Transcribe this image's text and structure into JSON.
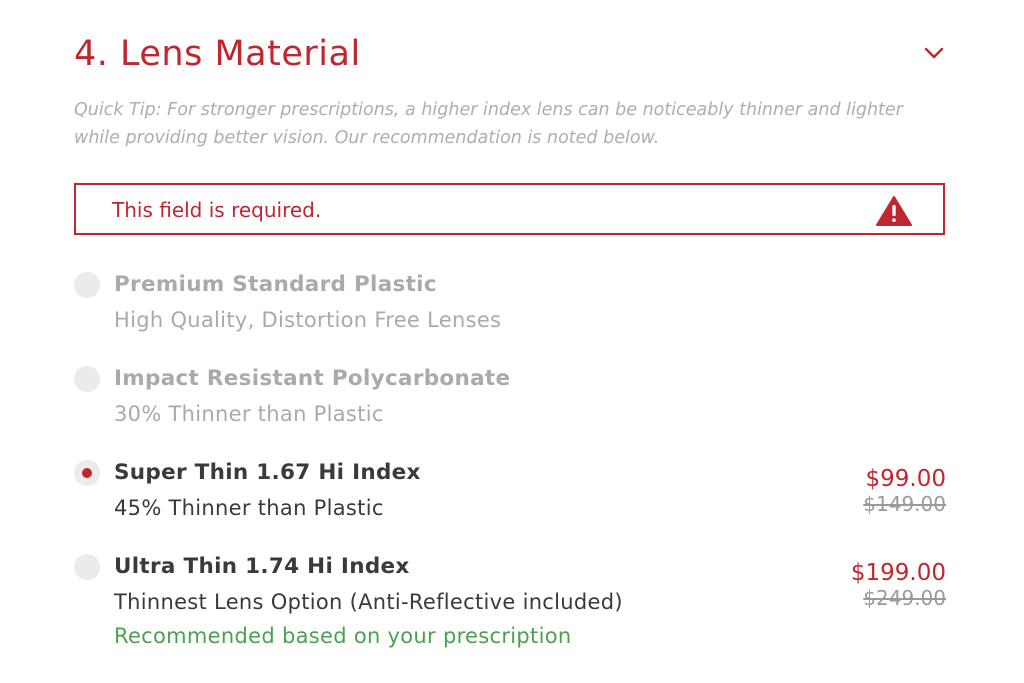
{
  "section": {
    "title": "4. Lens Material",
    "tip": "Quick Tip: For stronger prescriptions, a higher index lens can be noticeably thinner and lighter while providing better vision. Our recommendation is noted below.",
    "error": "This field is required."
  },
  "colors": {
    "accent": "#c0262d",
    "muted_text": "#aaaaaa",
    "active_text": "#3a3a3a",
    "recommend": "#4aa150"
  },
  "icons": {
    "collapse": "chevron-down-icon",
    "error": "warning-triangle-icon"
  },
  "options": [
    {
      "name": "Premium Standard Plastic",
      "desc": "High Quality, Distortion Free Lenses",
      "price": "",
      "old_price": "",
      "recommended": ""
    },
    {
      "name": "Impact Resistant Polycarbonate",
      "desc": "30% Thinner than Plastic",
      "price": "",
      "old_price": "",
      "recommended": ""
    },
    {
      "name": "Super Thin 1.67 Hi Index",
      "desc": "45% Thinner than Plastic",
      "price": "$99.00",
      "old_price": "$149.00",
      "recommended": "",
      "selected": true
    },
    {
      "name": "Ultra Thin 1.74 Hi Index",
      "desc": "Thinnest Lens Option (Anti-Reflective included)",
      "price": "$199.00",
      "old_price": "$249.00",
      "recommended": "Recommended based on your prescription"
    }
  ]
}
